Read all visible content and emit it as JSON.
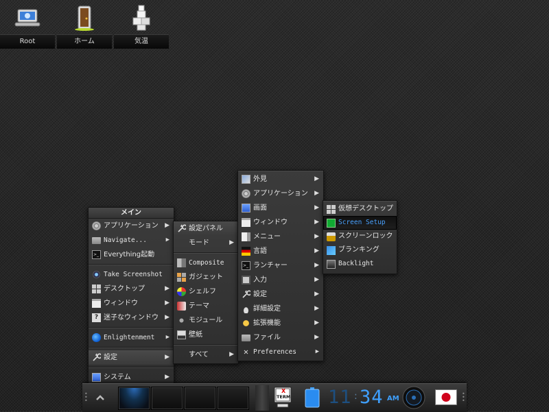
{
  "desktop_icons": [
    {
      "label": "Root",
      "icon": "computer-icon"
    },
    {
      "label": "ホーム",
      "icon": "home-door-icon"
    },
    {
      "label": "気温",
      "icon": "weather-icon"
    }
  ],
  "main_menu": {
    "title": "メイン",
    "items": [
      {
        "label": "アプリケーション",
        "icon": "gear-icon"
      },
      {
        "label": "Navigate...",
        "icon": "folder-icon"
      },
      {
        "label": "Everything起動",
        "icon": "terminal-icon"
      },
      {
        "label": "Take Screenshot",
        "icon": "camera-icon"
      },
      {
        "label": "デスクトップ",
        "icon": "desktop-grid-icon"
      },
      {
        "label": "ウィンドウ",
        "icon": "window-icon"
      },
      {
        "label": "迷子なウィンドウ",
        "icon": "question-icon"
      },
      {
        "label": "Enlightenment",
        "icon": "enlightenment-icon"
      },
      {
        "label": "設定",
        "icon": "wrench-icon"
      },
      {
        "label": "システム",
        "icon": "monitor-icon"
      }
    ]
  },
  "settings_menu": {
    "items": [
      {
        "label": "設定パネル",
        "icon": "wrench-icon"
      },
      {
        "label": "モード"
      },
      {
        "label": "Composite",
        "icon": "composite-icon"
      },
      {
        "label": "ガジェット",
        "icon": "gadget-icon"
      },
      {
        "label": "シェルフ",
        "icon": "shelf-icon"
      },
      {
        "label": "テーマ",
        "icon": "theme-icon"
      },
      {
        "label": "モジュール",
        "icon": "module-icon"
      },
      {
        "label": "壁紙",
        "icon": "wallpaper-icon"
      },
      {
        "label": "すべて"
      }
    ]
  },
  "panel_menu": {
    "items": [
      {
        "label": "外見",
        "icon": "appearance-icon"
      },
      {
        "label": "アプリケーション",
        "icon": "gear-icon"
      },
      {
        "label": "画面",
        "icon": "screen-icon"
      },
      {
        "label": "ウィンドウ",
        "icon": "window-icon"
      },
      {
        "label": "メニュー",
        "icon": "menu-icon"
      },
      {
        "label": "言語",
        "icon": "language-flag-icon"
      },
      {
        "label": "ランチャー",
        "icon": "launcher-icon"
      },
      {
        "label": "入力",
        "icon": "input-icon"
      },
      {
        "label": "設定",
        "icon": "wrench-icon"
      },
      {
        "label": "詳細設定",
        "icon": "advanced-icon"
      },
      {
        "label": "拡張機能",
        "icon": "puzzle-icon"
      },
      {
        "label": "ファイル",
        "icon": "folder-icon"
      },
      {
        "label": "Preferences",
        "icon": "preferences-icon"
      }
    ]
  },
  "screen_menu": {
    "items": [
      {
        "label": "仮想デスクトップ",
        "icon": "virtual-desktop-icon"
      },
      {
        "label": "Screen Setup",
        "icon": "screen-setup-icon",
        "selected": true
      },
      {
        "label": "スクリーンロック",
        "icon": "lock-icon"
      },
      {
        "label": "ブランキング",
        "icon": "blanking-icon"
      },
      {
        "label": "Backlight",
        "icon": "backlight-icon"
      }
    ]
  },
  "shelf": {
    "pager_desks": 4,
    "active_desk": 0,
    "xterm_label_x": "X",
    "xterm_label_term": "TERM",
    "clock": {
      "hours": "11",
      "minutes": "34",
      "ampm": "AM"
    },
    "battery_level": 1.0,
    "language_flag": "japan-flag-icon"
  },
  "colors": {
    "accent": "#3fa0ff",
    "selected_text": "#4ba3ff",
    "flag_red": "#d0021b"
  }
}
